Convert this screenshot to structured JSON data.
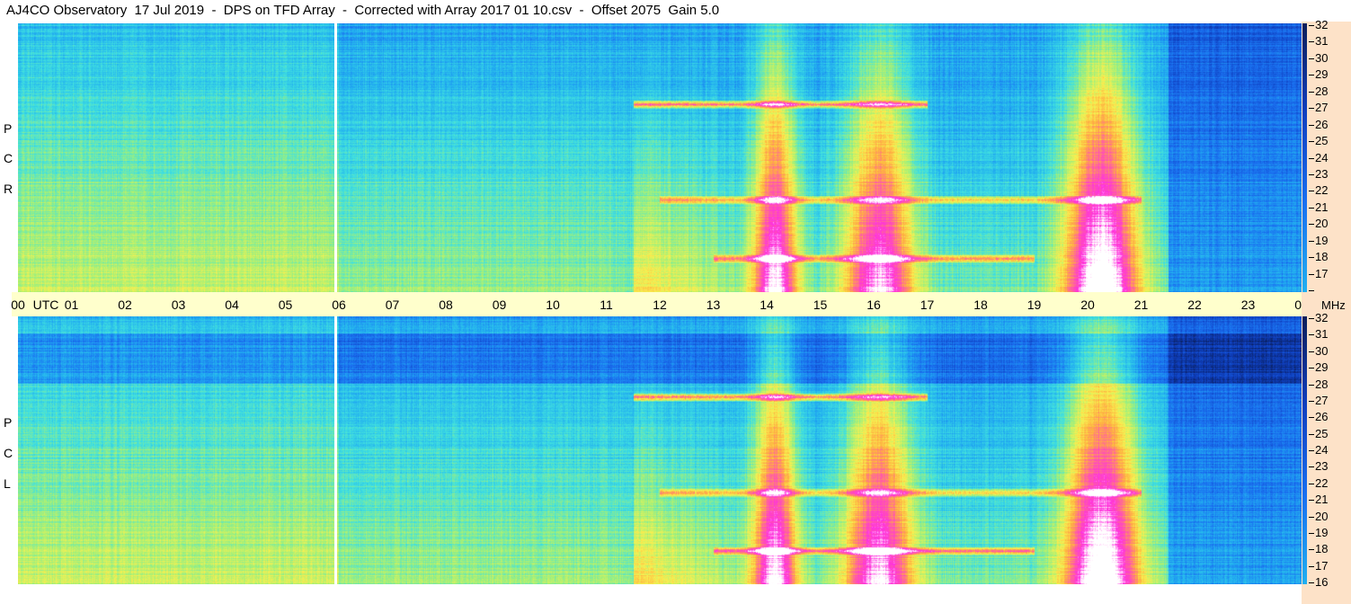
{
  "header": {
    "title": "AJ4CO Observatory  17 Jul 2019  -  DPS on TFD Array  -  Corrected with Array 2017 01 10.csv  -  Offset 2075  Gain 5.0"
  },
  "panels": [
    {
      "id": "rcp",
      "letters": [
        "R",
        "C",
        "P"
      ]
    },
    {
      "id": "lcp",
      "letters": [
        "L",
        "C",
        "P"
      ]
    }
  ],
  "colors": {
    "colormap": [
      "#0a1e5a",
      "#0f3fbf",
      "#1a6ff0",
      "#22b0f0",
      "#40e0e0",
      "#a0f07a",
      "#f8f050",
      "#ffb040",
      "#ff60a0",
      "#ff30e0",
      "#ffffff"
    ],
    "utc_strip": "#ffffcc",
    "right_strip": "#fde2c8"
  },
  "chart_data": {
    "type": "heatmap",
    "title": "AJ4CO Observatory  17 Jul 2019  -  DPS on TFD Array  -  Corrected with Array 2017 01 10.csv  -  Offset 2075  Gain 5.0",
    "xlabel": "UTC",
    "ylabel": "MHz",
    "x_ticks": [
      "00",
      "01",
      "02",
      "03",
      "04",
      "05",
      "06",
      "07",
      "08",
      "09",
      "10",
      "11",
      "12",
      "13",
      "14",
      "15",
      "16",
      "17",
      "18",
      "19",
      "20",
      "21",
      "22",
      "23",
      "00"
    ],
    "x_range_hours": [
      0,
      24
    ],
    "y_ticks": [
      "32",
      "31",
      "30",
      "29",
      "28",
      "27",
      "26",
      "25",
      "24",
      "23",
      "22",
      "21",
      "20",
      "19",
      "18",
      "17",
      "16"
    ],
    "y_range_mhz": [
      16,
      32
    ],
    "panels": [
      "RCP",
      "LCP"
    ],
    "data_gap_hour": 5.85,
    "features": [
      {
        "kind": "broadband_vertical",
        "hour_start": 13.7,
        "hour_end": 14.6,
        "intensity": 0.85
      },
      {
        "kind": "broadband_vertical",
        "hour_start": 15.4,
        "hour_end": 16.8,
        "intensity": 0.8
      },
      {
        "kind": "broadband_vertical",
        "hour_start": 19.5,
        "hour_end": 21.0,
        "intensity": 1.0
      },
      {
        "kind": "rfi_band",
        "mhz": 27.2,
        "hour_start": 11.5,
        "hour_end": 17.0,
        "intensity": 0.9
      },
      {
        "kind": "rfi_band",
        "mhz": 18.0,
        "hour_start": 13.0,
        "hour_end": 19.0,
        "intensity": 0.7
      },
      {
        "kind": "rfi_band",
        "mhz": 21.5,
        "hour_start": 12.0,
        "hour_end": 21.0,
        "intensity": 0.6
      }
    ]
  }
}
